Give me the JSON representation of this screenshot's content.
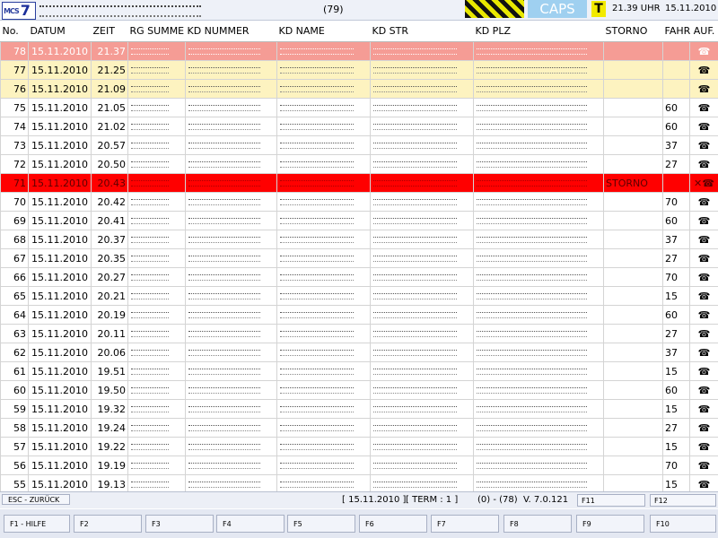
{
  "header": {
    "logo_text": "MCS",
    "logo_num": "7",
    "count": "(79)",
    "caps": "CAPS ON",
    "term_badge": "T",
    "time": "21.39 UHR",
    "date": "15.11.2010"
  },
  "columns": [
    "No.",
    "DATUM",
    "ZEIT",
    "RG SUMME",
    "KD NUMMER",
    "KD NAME",
    "KD STR",
    "KD PLZ",
    "STORNO",
    "FAHR AUF."
  ],
  "rows": [
    {
      "no": "78",
      "datum": "15.11.2010",
      "zeit": "21.37",
      "state": "red-light",
      "fahr": "",
      "storno": "",
      "x": false
    },
    {
      "no": "77",
      "datum": "15.11.2010",
      "zeit": "21.25",
      "state": "yellow",
      "fahr": "",
      "storno": "",
      "x": false
    },
    {
      "no": "76",
      "datum": "15.11.2010",
      "zeit": "21.09",
      "state": "yellow",
      "fahr": "",
      "storno": "",
      "x": false
    },
    {
      "no": "75",
      "datum": "15.11.2010",
      "zeit": "21.05",
      "state": "white",
      "fahr": "60",
      "storno": "",
      "x": false
    },
    {
      "no": "74",
      "datum": "15.11.2010",
      "zeit": "21.02",
      "state": "white",
      "fahr": "60",
      "storno": "",
      "x": false
    },
    {
      "no": "73",
      "datum": "15.11.2010",
      "zeit": "20.57",
      "state": "white",
      "fahr": "37",
      "storno": "",
      "x": false
    },
    {
      "no": "72",
      "datum": "15.11.2010",
      "zeit": "20.50",
      "state": "white",
      "fahr": "27",
      "storno": "",
      "x": false
    },
    {
      "no": "71",
      "datum": "15.11.2010",
      "zeit": "20.43",
      "state": "red",
      "fahr": "",
      "storno": "STORNO",
      "x": true
    },
    {
      "no": "70",
      "datum": "15.11.2010",
      "zeit": "20.42",
      "state": "white",
      "fahr": "70",
      "storno": "",
      "x": false
    },
    {
      "no": "69",
      "datum": "15.11.2010",
      "zeit": "20.41",
      "state": "white",
      "fahr": "60",
      "storno": "",
      "x": false
    },
    {
      "no": "68",
      "datum": "15.11.2010",
      "zeit": "20.37",
      "state": "white",
      "fahr": "37",
      "storno": "",
      "x": false
    },
    {
      "no": "67",
      "datum": "15.11.2010",
      "zeit": "20.35",
      "state": "white",
      "fahr": "27",
      "storno": "",
      "x": false
    },
    {
      "no": "66",
      "datum": "15.11.2010",
      "zeit": "20.27",
      "state": "white",
      "fahr": "70",
      "storno": "",
      "x": false
    },
    {
      "no": "65",
      "datum": "15.11.2010",
      "zeit": "20.21",
      "state": "white",
      "fahr": "15",
      "storno": "",
      "x": false
    },
    {
      "no": "64",
      "datum": "15.11.2010",
      "zeit": "20.19",
      "state": "white",
      "fahr": "60",
      "storno": "",
      "x": false
    },
    {
      "no": "63",
      "datum": "15.11.2010",
      "zeit": "20.11",
      "state": "white",
      "fahr": "27",
      "storno": "",
      "x": false
    },
    {
      "no": "62",
      "datum": "15.11.2010",
      "zeit": "20.06",
      "state": "white",
      "fahr": "37",
      "storno": "",
      "x": false
    },
    {
      "no": "61",
      "datum": "15.11.2010",
      "zeit": "19.51",
      "state": "white",
      "fahr": "15",
      "storno": "",
      "x": false
    },
    {
      "no": "60",
      "datum": "15.11.2010",
      "zeit": "19.50",
      "state": "white",
      "fahr": "60",
      "storno": "",
      "x": false
    },
    {
      "no": "59",
      "datum": "15.11.2010",
      "zeit": "19.32",
      "state": "white",
      "fahr": "15",
      "storno": "",
      "x": false
    },
    {
      "no": "58",
      "datum": "15.11.2010",
      "zeit": "19.24",
      "state": "white",
      "fahr": "27",
      "storno": "",
      "x": false
    },
    {
      "no": "57",
      "datum": "15.11.2010",
      "zeit": "19.22",
      "state": "white",
      "fahr": "15",
      "storno": "",
      "x": false
    },
    {
      "no": "56",
      "datum": "15.11.2010",
      "zeit": "19.19",
      "state": "white",
      "fahr": "70",
      "storno": "",
      "x": false
    },
    {
      "no": "55",
      "datum": "15.11.2010",
      "zeit": "19.13",
      "state": "white",
      "fahr": "15",
      "storno": "",
      "x": false
    }
  ],
  "status": {
    "esc": "ESC - ZURÜCK",
    "date": "[ 15.11.2010 ]",
    "term": "[ TERM : 1 ]",
    "count": "(0) - (78)",
    "version": "V. 7.0.121",
    "f11": "F11",
    "f12": "F12"
  },
  "fkeys": [
    "F1 - HILFE",
    "F2",
    "F3",
    "F4",
    "F5",
    "F6",
    "F7",
    "F8",
    "F9",
    "F10"
  ],
  "colors": {
    "red": "#ff0000",
    "red_light": "#f59c95",
    "yellow": "#fdf3c0"
  }
}
